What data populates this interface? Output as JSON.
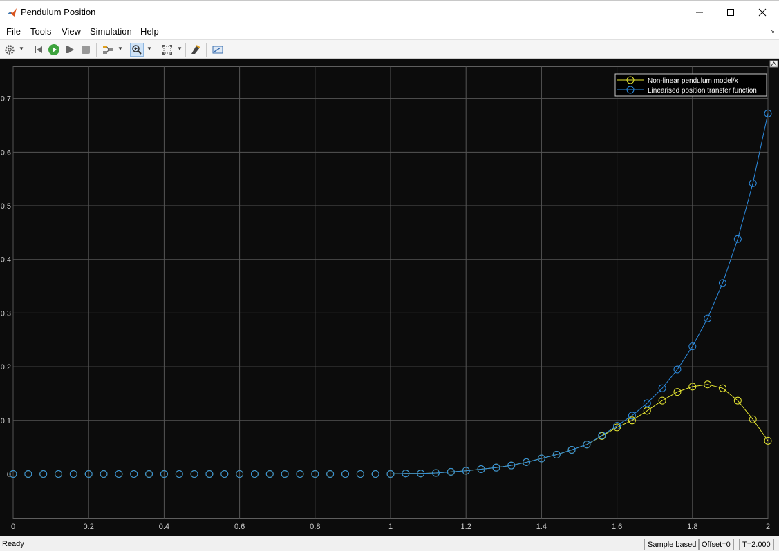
{
  "window": {
    "title": "Pendulum Position"
  },
  "menu": [
    "File",
    "Tools",
    "View",
    "Simulation",
    "Help"
  ],
  "toolbar": {
    "icons": [
      "settings-icon",
      "step-back-icon",
      "run-icon",
      "step-forward-icon",
      "stop-icon",
      "signal-selector-icon",
      "zoom-in-icon",
      "autoscale-icon",
      "highlight-block-icon",
      "properties-icon"
    ],
    "active": "zoom-in-icon"
  },
  "status": {
    "left": "Ready",
    "mode": "Sample based",
    "offset": "Offset=0",
    "time": "T=2.000"
  },
  "colors": {
    "background": "#0c0c0c",
    "grid": "#555555",
    "tick_text": "#d0d0d0",
    "series1": "#e6e632",
    "series2": "#2d8ce0"
  },
  "chart_data": {
    "type": "line",
    "title": "",
    "xlabel": "",
    "ylabel": "",
    "xlim": [
      0,
      2
    ],
    "ylim": [
      -0.083,
      0.76
    ],
    "xticks": [
      0,
      0.2,
      0.4,
      0.6,
      0.8,
      1,
      1.2,
      1.4,
      1.6,
      1.8,
      2
    ],
    "yticks": [
      0,
      0.1,
      0.2,
      0.3,
      0.4,
      0.5,
      0.6,
      0.7
    ],
    "grid": true,
    "legend_position": "top-right",
    "marker": "circle",
    "series": [
      {
        "name": "Non-linear pendulum model/x",
        "x": [
          0,
          0.04,
          0.08,
          0.12,
          0.16,
          0.2,
          0.24,
          0.28,
          0.32,
          0.36,
          0.4,
          0.44,
          0.48,
          0.52,
          0.56,
          0.6,
          0.64,
          0.68,
          0.72,
          0.76,
          0.8,
          0.84,
          0.88,
          0.92,
          0.96,
          1,
          1.04,
          1.08,
          1.12,
          1.16,
          1.2,
          1.24,
          1.28,
          1.32,
          1.36,
          1.4,
          1.44,
          1.48,
          1.52,
          1.56,
          1.6,
          1.64,
          1.68,
          1.72,
          1.76,
          1.8,
          1.84,
          1.88,
          1.92,
          1.96,
          2
        ],
        "y": [
          0,
          0,
          0,
          0,
          0,
          0,
          0,
          0,
          0,
          0,
          0,
          0,
          0,
          0,
          0,
          0,
          0,
          0,
          0,
          0,
          0,
          0,
          0,
          0,
          0,
          0,
          0.001,
          0.001,
          0.002,
          0.004,
          0.006,
          0.009,
          0.012,
          0.016,
          0.022,
          0.029,
          0.036,
          0.045,
          0.055,
          0.071,
          0.087,
          0.1,
          0.118,
          0.137,
          0.153,
          0.163,
          0.167,
          0.16,
          0.137,
          0.102,
          0.062
        ]
      },
      {
        "name": "Linearised position transfer function",
        "x": [
          0,
          0.04,
          0.08,
          0.12,
          0.16,
          0.2,
          0.24,
          0.28,
          0.32,
          0.36,
          0.4,
          0.44,
          0.48,
          0.52,
          0.56,
          0.6,
          0.64,
          0.68,
          0.72,
          0.76,
          0.8,
          0.84,
          0.88,
          0.92,
          0.96,
          1,
          1.04,
          1.08,
          1.12,
          1.16,
          1.2,
          1.24,
          1.28,
          1.32,
          1.36,
          1.4,
          1.44,
          1.48,
          1.52,
          1.56,
          1.6,
          1.64,
          1.68,
          1.72,
          1.76,
          1.8,
          1.84,
          1.88,
          1.92,
          1.96,
          2
        ],
        "y": [
          0,
          0,
          0,
          0,
          0,
          0,
          0,
          0,
          0,
          0,
          0,
          0,
          0,
          0,
          0,
          0,
          0,
          0,
          0,
          0,
          0,
          0,
          0,
          0,
          0,
          0,
          0.001,
          0.001,
          0.002,
          0.004,
          0.006,
          0.009,
          0.012,
          0.016,
          0.022,
          0.029,
          0.036,
          0.045,
          0.055,
          0.072,
          0.09,
          0.109,
          0.132,
          0.16,
          0.195,
          0.238,
          0.29,
          0.356,
          0.438,
          0.542,
          0.672
        ]
      }
    ]
  }
}
